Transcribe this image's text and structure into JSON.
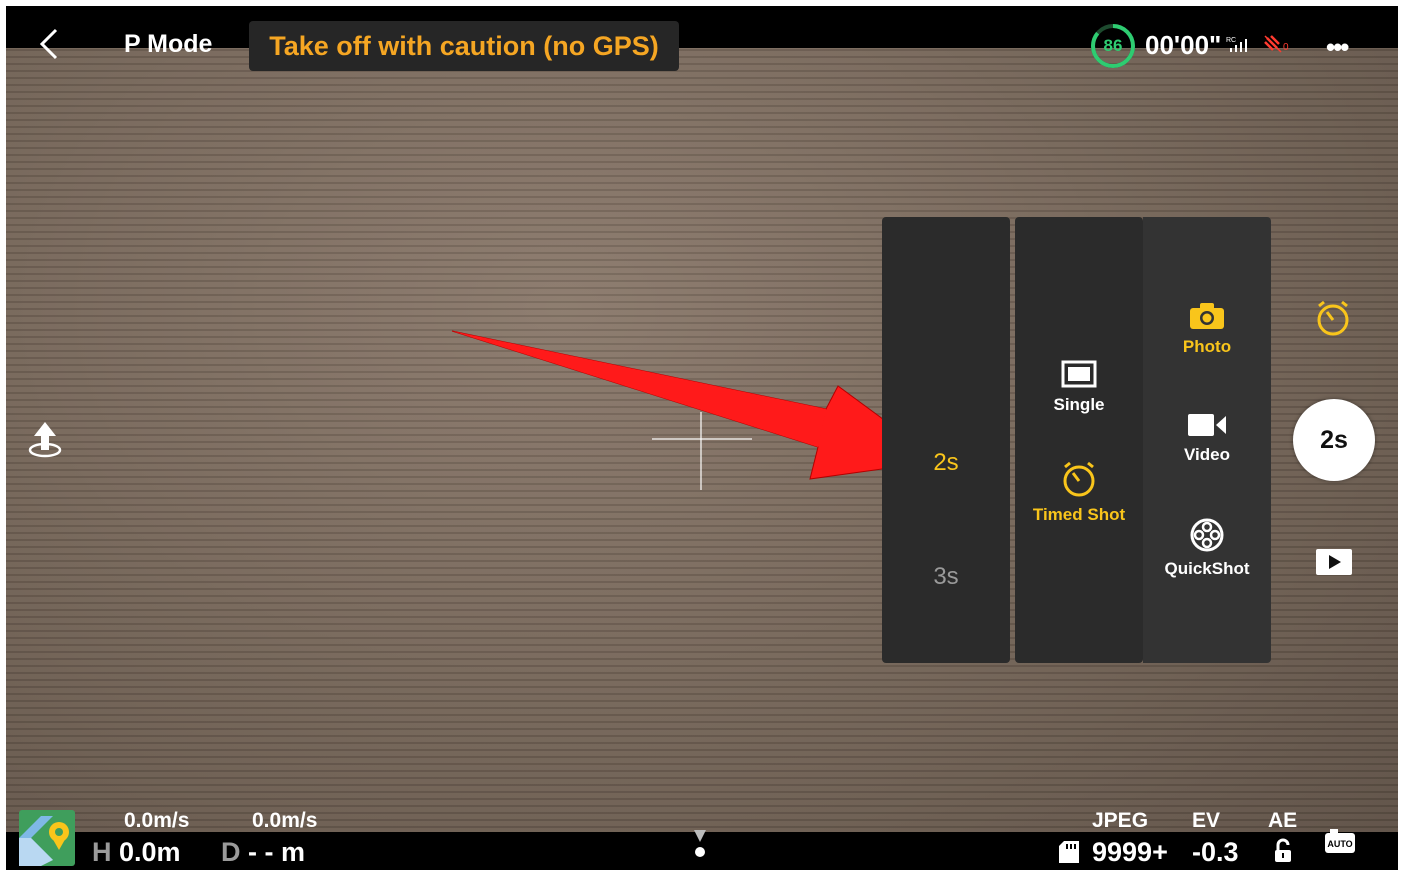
{
  "top_bar": {
    "mode": "P Mode",
    "warning": "Take off with caution (no GPS)",
    "battery_percent": "86",
    "flight_time": "00'00\"",
    "rc_label": "RC",
    "gps_count": "0"
  },
  "timer_options": {
    "selected": "2s",
    "other": "3s"
  },
  "shoot_types": [
    {
      "label": "Single",
      "icon": "single-frame-icon",
      "selected": false
    },
    {
      "label": "Timed Shot",
      "icon": "timer-icon",
      "selected": true
    }
  ],
  "camera_modes": [
    {
      "label": "Photo",
      "icon": "camera-icon",
      "selected": true
    },
    {
      "label": "Video",
      "icon": "video-camera-icon",
      "selected": false
    },
    {
      "label": "QuickShot",
      "icon": "film-reel-icon",
      "selected": false
    }
  ],
  "shutter": {
    "label": "2s"
  },
  "telemetry": {
    "horizontal_speed": "0.0m/s",
    "vertical_speed": "0.0m/s",
    "height_prefix": "H",
    "height": "0.0m",
    "distance_prefix": "D",
    "distance": "- - m"
  },
  "camera_info": {
    "format": "JPEG",
    "ev_label": "EV",
    "ae_label": "AE",
    "shots_remaining": "9999+",
    "ev_value": "-0.3",
    "auto_label": "AUTO"
  },
  "colors": {
    "accent_yellow": "#f9c51b",
    "warning_orange": "#f5a623",
    "battery_green": "#2ecc71",
    "annotation_red": "#ff1a1a"
  }
}
